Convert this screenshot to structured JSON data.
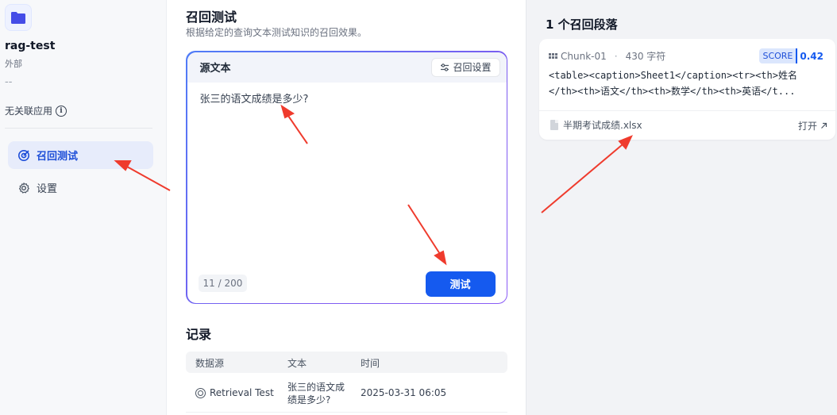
{
  "sidebar": {
    "kb_name": "rag-test",
    "kb_type": "外部",
    "kb_desc": "--",
    "no_app": "无关联应用",
    "info_icon": "info-icon",
    "nav": [
      {
        "label": "召回测试",
        "icon": "target-icon",
        "active": true
      },
      {
        "label": "设置",
        "icon": "gear-icon",
        "active": false
      }
    ]
  },
  "main": {
    "title": "召回测试",
    "subtitle": "根据给定的查询文本测试知识的召回效果。",
    "source_label": "源文本",
    "setting_button": "召回设置",
    "query_text": "张三的语文成绩是多少?",
    "counter": "11 / 200",
    "test_button": "测试",
    "records_title": "记录",
    "records_columns": [
      "数据源",
      "文本",
      "时间"
    ],
    "records": [
      {
        "source": "Retrieval Test",
        "text_line1": "张三的语文成",
        "text_line2": "绩是多少?",
        "time": "2025-03-31 06:05"
      }
    ]
  },
  "results": {
    "title": "1 个召回段落",
    "chunk": {
      "id": "Chunk-01",
      "separator": "·",
      "chars": "430 字符",
      "score_label": "SCORE",
      "score_value": "0.42",
      "line1": "<table><caption>Sheet1</caption><tr><th>姓名",
      "line2": "</th><th>语文</th><th>数学</th><th>英语</t...",
      "file": "半期考试成绩.xlsx",
      "open": "打开"
    }
  },
  "colors": {
    "accent": "#155aef",
    "annotation": "#ef3b2d"
  }
}
